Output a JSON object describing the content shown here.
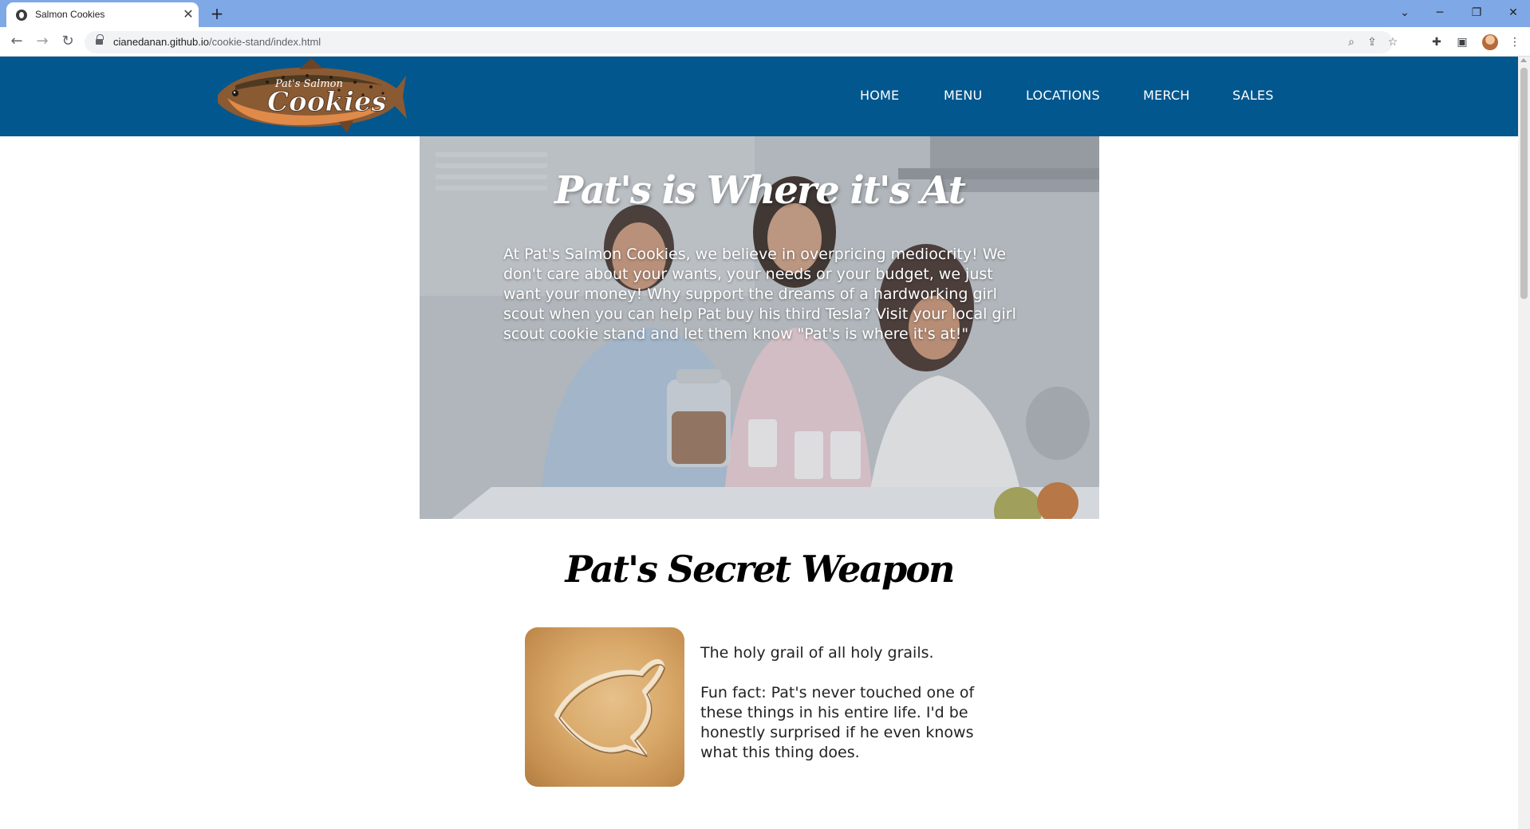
{
  "browser": {
    "tab_title": "Salmon Cookies",
    "tab_close": "✕",
    "new_tab": "+",
    "url_host": "cianedanan.github.io",
    "url_path": "/cookie-stand/index.html",
    "window_controls": [
      "⌄",
      "─",
      "❐",
      "✕"
    ]
  },
  "site": {
    "logo_text": "Pat's Salmon Cookies",
    "nav": [
      "HOME",
      "MENU",
      "LOCATIONS",
      "MERCH",
      "SALES"
    ]
  },
  "hero": {
    "title": "Pat's is Where it's At",
    "text": "At Pat's Salmon Cookies, we believe in overpricing mediocrity! We don't care about your wants, your needs or your budget, we just want your money! Why support the dreams of a hardworking girl scout when you can help Pat buy his third Tesla? Visit your local girl scout cookie stand and let them know \"Pat's is where it's at!\""
  },
  "secret_weapon": {
    "title": "Pat's Secret Weapon",
    "para1": "The holy grail of all holy grails.",
    "para2": "Fun fact: Pat's never touched one of these things in his entire life. I'd be honestly surprised if he even knows what this thing does."
  },
  "colors": {
    "header_bg": "#02578e",
    "tabstrip_bg": "#7fa9e6"
  }
}
